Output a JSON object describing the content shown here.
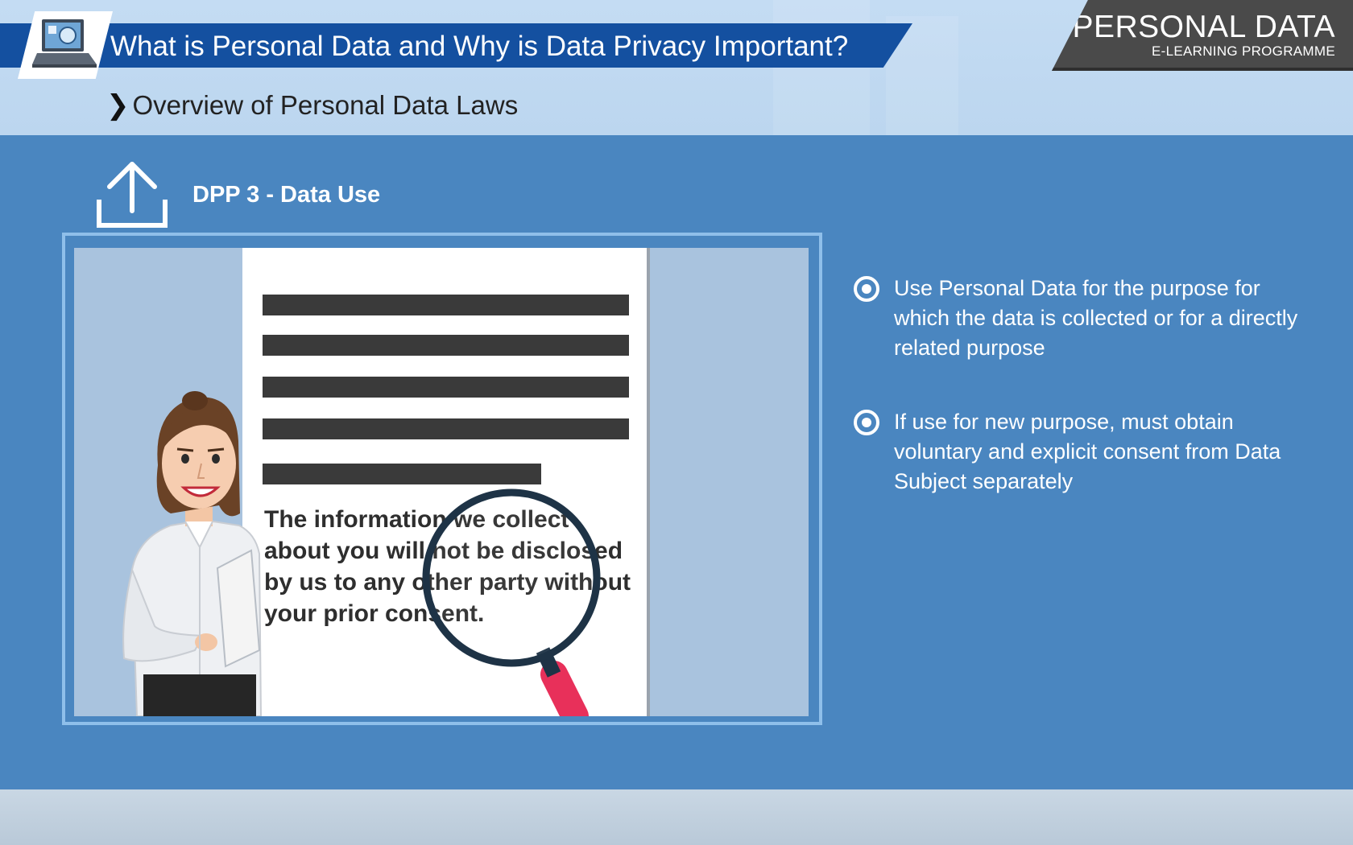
{
  "header": {
    "title": "What is Personal Data and Why is Data Privacy Important?",
    "brand_title": "PERSONAL DATA",
    "brand_subtitle": "E-LEARNING PROGRAMME"
  },
  "section": {
    "chevron": "❯",
    "title": "Overview of Personal Data Laws"
  },
  "principle": {
    "icon": "upload-icon",
    "title": "DPP 3 - Data Use"
  },
  "illustration": {
    "document_text": "The information we collect about you will not be disclosed by us to any other party without your prior consent."
  },
  "bullets": [
    {
      "icon": "radio-bullet-icon",
      "text": "Use Personal Data for the purpose for which the data is collected or for a directly related purpose"
    },
    {
      "icon": "radio-bullet-icon",
      "text": "If use for new purpose, must obtain voluntary and explicit consent from Data Subject separately"
    }
  ],
  "colors": {
    "banner": "#1450a0",
    "panel": "#4a86c0",
    "brand": "#4a4a4a",
    "magnifier_handle": "#e8305a"
  }
}
